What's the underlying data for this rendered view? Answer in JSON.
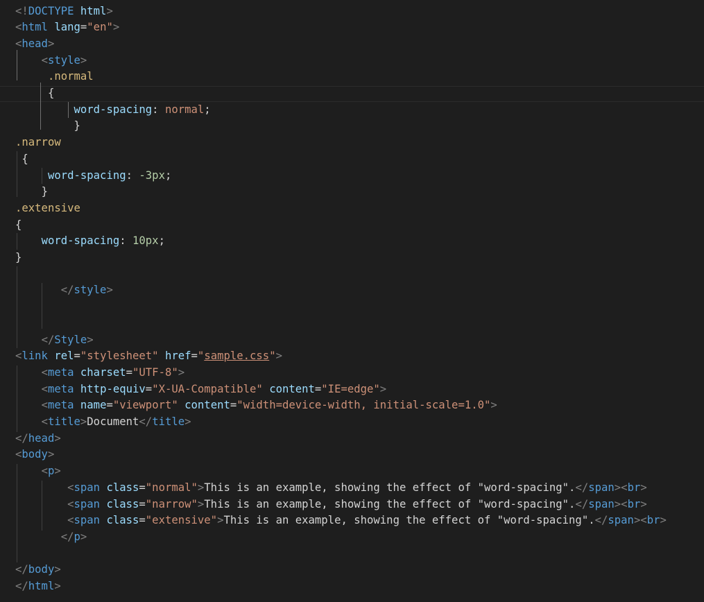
{
  "editor": {
    "theme": {
      "background": "#1e1e1e",
      "tag": "#569cd6",
      "attribute": "#9cdcfe",
      "string": "#ce9178",
      "selector": "#d7ba7d",
      "number": "#b5cea8",
      "text": "#d4d4d4",
      "bracket": "#808080"
    },
    "lines": [
      [
        {
          "t": "<!",
          "c": "bracket"
        },
        {
          "t": "DOCTYPE",
          "c": "tag"
        },
        {
          "t": " ",
          "c": "text"
        },
        {
          "t": "html",
          "c": "attr"
        },
        {
          "t": ">",
          "c": "bracket"
        }
      ],
      [
        {
          "t": "<",
          "c": "bracket"
        },
        {
          "t": "html",
          "c": "tag"
        },
        {
          "t": " ",
          "c": "text"
        },
        {
          "t": "lang",
          "c": "attr"
        },
        {
          "t": "=",
          "c": "text"
        },
        {
          "t": "\"en\"",
          "c": "str"
        },
        {
          "t": ">",
          "c": "bracket"
        }
      ],
      [
        {
          "t": "<",
          "c": "bracket"
        },
        {
          "t": "head",
          "c": "tag"
        },
        {
          "t": ">",
          "c": "bracket"
        }
      ],
      [
        {
          "t": "    ",
          "c": "text"
        },
        {
          "t": "<",
          "c": "bracket"
        },
        {
          "t": "style",
          "c": "tag"
        },
        {
          "t": ">",
          "c": "bracket"
        }
      ],
      [
        {
          "t": "     ",
          "c": "text"
        },
        {
          "t": ".normal",
          "c": "sel"
        }
      ],
      [
        {
          "t": "     ",
          "c": "text"
        },
        {
          "t": "{",
          "c": "text"
        }
      ],
      [
        {
          "t": "         ",
          "c": "text"
        },
        {
          "t": "word-spacing",
          "c": "prop"
        },
        {
          "t": ": ",
          "c": "text"
        },
        {
          "t": "normal",
          "c": "str"
        },
        {
          "t": ";",
          "c": "text"
        }
      ],
      [
        {
          "t": "         ",
          "c": "text"
        },
        {
          "t": "}",
          "c": "text"
        }
      ],
      [
        {
          "t": ".narrow",
          "c": "sel"
        }
      ],
      [
        {
          "t": " ",
          "c": "text"
        },
        {
          "t": "{",
          "c": "text"
        }
      ],
      [
        {
          "t": "     ",
          "c": "text"
        },
        {
          "t": "word-spacing",
          "c": "prop"
        },
        {
          "t": ": ",
          "c": "text"
        },
        {
          "t": "-3px",
          "c": "num"
        },
        {
          "t": ";",
          "c": "text"
        }
      ],
      [
        {
          "t": "    ",
          "c": "text"
        },
        {
          "t": "}",
          "c": "text"
        }
      ],
      [
        {
          "t": ".extensive",
          "c": "sel"
        }
      ],
      [
        {
          "t": "{",
          "c": "text"
        }
      ],
      [
        {
          "t": "    ",
          "c": "text"
        },
        {
          "t": "word-spacing",
          "c": "prop"
        },
        {
          "t": ": ",
          "c": "text"
        },
        {
          "t": "10px",
          "c": "num"
        },
        {
          "t": ";",
          "c": "text"
        }
      ],
      [
        {
          "t": "}",
          "c": "text"
        }
      ],
      [
        {
          "t": "",
          "c": "text"
        }
      ],
      [
        {
          "t": "       ",
          "c": "text"
        },
        {
          "t": "</",
          "c": "bracket"
        },
        {
          "t": "style",
          "c": "tag"
        },
        {
          "t": ">",
          "c": "bracket"
        }
      ],
      [
        {
          "t": "",
          "c": "text"
        }
      ],
      [
        {
          "t": "",
          "c": "text"
        }
      ],
      [
        {
          "t": "    ",
          "c": "text"
        },
        {
          "t": "</",
          "c": "bracket"
        },
        {
          "t": "Style",
          "c": "tag"
        },
        {
          "t": ">",
          "c": "bracket"
        }
      ],
      [
        {
          "t": "<",
          "c": "bracket"
        },
        {
          "t": "link",
          "c": "tag"
        },
        {
          "t": " ",
          "c": "text"
        },
        {
          "t": "rel",
          "c": "attr"
        },
        {
          "t": "=",
          "c": "text"
        },
        {
          "t": "\"stylesheet\"",
          "c": "str"
        },
        {
          "t": " ",
          "c": "text"
        },
        {
          "t": "href",
          "c": "attr"
        },
        {
          "t": "=",
          "c": "text"
        },
        {
          "t": "\"",
          "c": "str"
        },
        {
          "t": "sample.css",
          "c": "link"
        },
        {
          "t": "\"",
          "c": "str"
        },
        {
          "t": ">",
          "c": "bracket"
        }
      ],
      [
        {
          "t": "    ",
          "c": "text"
        },
        {
          "t": "<",
          "c": "bracket"
        },
        {
          "t": "meta",
          "c": "tag"
        },
        {
          "t": " ",
          "c": "text"
        },
        {
          "t": "charset",
          "c": "attr"
        },
        {
          "t": "=",
          "c": "text"
        },
        {
          "t": "\"UTF-8\"",
          "c": "str"
        },
        {
          "t": ">",
          "c": "bracket"
        }
      ],
      [
        {
          "t": "    ",
          "c": "text"
        },
        {
          "t": "<",
          "c": "bracket"
        },
        {
          "t": "meta",
          "c": "tag"
        },
        {
          "t": " ",
          "c": "text"
        },
        {
          "t": "http-equiv",
          "c": "attr"
        },
        {
          "t": "=",
          "c": "text"
        },
        {
          "t": "\"X-UA-Compatible\"",
          "c": "str"
        },
        {
          "t": " ",
          "c": "text"
        },
        {
          "t": "content",
          "c": "attr"
        },
        {
          "t": "=",
          "c": "text"
        },
        {
          "t": "\"IE=edge\"",
          "c": "str"
        },
        {
          "t": ">",
          "c": "bracket"
        }
      ],
      [
        {
          "t": "    ",
          "c": "text"
        },
        {
          "t": "<",
          "c": "bracket"
        },
        {
          "t": "meta",
          "c": "tag"
        },
        {
          "t": " ",
          "c": "text"
        },
        {
          "t": "name",
          "c": "attr"
        },
        {
          "t": "=",
          "c": "text"
        },
        {
          "t": "\"viewport\"",
          "c": "str"
        },
        {
          "t": " ",
          "c": "text"
        },
        {
          "t": "content",
          "c": "attr"
        },
        {
          "t": "=",
          "c": "text"
        },
        {
          "t": "\"width=device-width, initial-scale=1.0\"",
          "c": "str"
        },
        {
          "t": ">",
          "c": "bracket"
        }
      ],
      [
        {
          "t": "    ",
          "c": "text"
        },
        {
          "t": "<",
          "c": "bracket"
        },
        {
          "t": "title",
          "c": "tag"
        },
        {
          "t": ">",
          "c": "bracket"
        },
        {
          "t": "Document",
          "c": "text"
        },
        {
          "t": "</",
          "c": "bracket"
        },
        {
          "t": "title",
          "c": "tag"
        },
        {
          "t": ">",
          "c": "bracket"
        }
      ],
      [
        {
          "t": "</",
          "c": "bracket"
        },
        {
          "t": "head",
          "c": "tag"
        },
        {
          "t": ">",
          "c": "bracket"
        }
      ],
      [
        {
          "t": "<",
          "c": "bracket"
        },
        {
          "t": "body",
          "c": "tag"
        },
        {
          "t": ">",
          "c": "bracket"
        }
      ],
      [
        {
          "t": "    ",
          "c": "text"
        },
        {
          "t": "<",
          "c": "bracket"
        },
        {
          "t": "p",
          "c": "tag"
        },
        {
          "t": ">",
          "c": "bracket"
        }
      ],
      [
        {
          "t": "        ",
          "c": "text"
        },
        {
          "t": "<",
          "c": "bracket"
        },
        {
          "t": "span",
          "c": "tag"
        },
        {
          "t": " ",
          "c": "text"
        },
        {
          "t": "class",
          "c": "attr"
        },
        {
          "t": "=",
          "c": "text"
        },
        {
          "t": "\"normal\"",
          "c": "str"
        },
        {
          "t": ">",
          "c": "bracket"
        },
        {
          "t": "This is an example, showing the effect of \"word-spacing\".",
          "c": "text"
        },
        {
          "t": "</",
          "c": "bracket"
        },
        {
          "t": "span",
          "c": "tag"
        },
        {
          "t": "><",
          "c": "bracket"
        },
        {
          "t": "br",
          "c": "tag"
        },
        {
          "t": ">",
          "c": "bracket"
        }
      ],
      [
        {
          "t": "        ",
          "c": "text"
        },
        {
          "t": "<",
          "c": "bracket"
        },
        {
          "t": "span",
          "c": "tag"
        },
        {
          "t": " ",
          "c": "text"
        },
        {
          "t": "class",
          "c": "attr"
        },
        {
          "t": "=",
          "c": "text"
        },
        {
          "t": "\"narrow\"",
          "c": "str"
        },
        {
          "t": ">",
          "c": "bracket"
        },
        {
          "t": "This is an example, showing the effect of \"word-spacing\".",
          "c": "text"
        },
        {
          "t": "</",
          "c": "bracket"
        },
        {
          "t": "span",
          "c": "tag"
        },
        {
          "t": "><",
          "c": "bracket"
        },
        {
          "t": "br",
          "c": "tag"
        },
        {
          "t": ">",
          "c": "bracket"
        }
      ],
      [
        {
          "t": "        ",
          "c": "text"
        },
        {
          "t": "<",
          "c": "bracket"
        },
        {
          "t": "span",
          "c": "tag"
        },
        {
          "t": " ",
          "c": "text"
        },
        {
          "t": "class",
          "c": "attr"
        },
        {
          "t": "=",
          "c": "text"
        },
        {
          "t": "\"extensive\"",
          "c": "str"
        },
        {
          "t": ">",
          "c": "bracket"
        },
        {
          "t": "This is an example, showing the effect of \"word-spacing\".",
          "c": "text"
        },
        {
          "t": "</",
          "c": "bracket"
        },
        {
          "t": "span",
          "c": "tag"
        },
        {
          "t": "><",
          "c": "bracket"
        },
        {
          "t": "br",
          "c": "tag"
        },
        {
          "t": ">",
          "c": "bracket"
        }
      ],
      [
        {
          "t": "       ",
          "c": "text"
        },
        {
          "t": "</",
          "c": "bracket"
        },
        {
          "t": "p",
          "c": "tag"
        },
        {
          "t": ">",
          "c": "bracket"
        }
      ],
      [
        {
          "t": "",
          "c": "text"
        }
      ],
      [
        {
          "t": "</",
          "c": "bracket"
        },
        {
          "t": "body",
          "c": "tag"
        },
        {
          "t": ">",
          "c": "bracket"
        }
      ],
      [
        {
          "t": "</",
          "c": "bracket"
        },
        {
          "t": "html",
          "c": "tag"
        },
        {
          "t": ">",
          "c": "bracket"
        }
      ]
    ]
  }
}
